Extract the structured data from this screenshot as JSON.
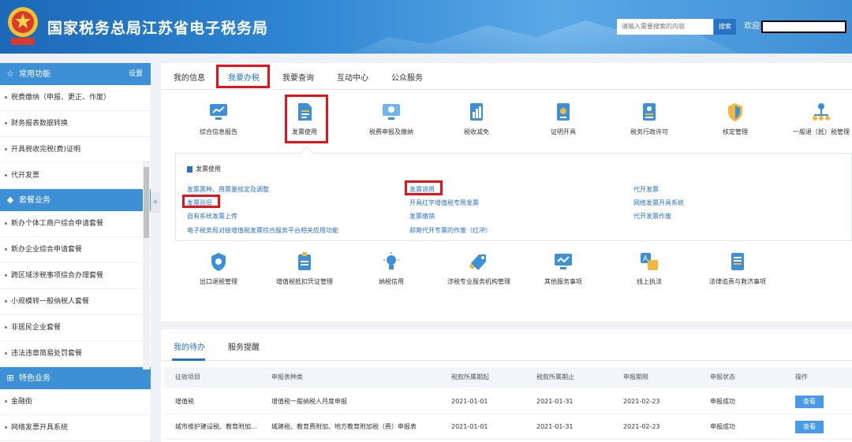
{
  "header": {
    "site_title": "国家税务总局江苏省电子税务局",
    "search_placeholder": "请输入需要搜索的内容",
    "search_label": "搜索",
    "welcome": "欢迎"
  },
  "sidebar": {
    "common": {
      "title": "常用功能",
      "settings": "设置",
      "items": [
        "税费缴纳（申报、更正、作废）",
        "财务报表数据转换",
        "开具税收完税(费)证明",
        "代开发票"
      ]
    },
    "packages": {
      "title": "套餐业务",
      "items": [
        "新办个体工商户综合申请套餐",
        "新办企业综合申请套餐",
        "跨区域涉税事项综合办理套餐",
        "小规模转一般纳税人套餐",
        "非居民企业套餐",
        "违法违章简易处罚套餐"
      ]
    },
    "featured": {
      "title": "特色业务",
      "items": [
        "金融街",
        "网络发票开具系统"
      ]
    }
  },
  "tabs": [
    "我的信息",
    "我要办税",
    "我要查询",
    "互动中心",
    "公众服务"
  ],
  "services_row1": [
    "综合信息报告",
    "发票使用",
    "税费申报及缴纳",
    "税收减免",
    "证明开具",
    "税务行政许可",
    "核定管理",
    "一般退（抵）税管理"
  ],
  "invoice_panel": {
    "title": "发票使用",
    "col1": [
      "发票票种、用票量核定及调整",
      "发票验旧",
      "自有系统发票上传",
      "电子税务局对接增值税发票综合服务平台相关应用功能"
    ],
    "col2": [
      "发票领用",
      "开具红字增值税专用发票",
      "发票缴销",
      "邮寄代开专票的作废（红冲）"
    ],
    "col3": [
      "代开发票",
      "网络发票开具系统",
      "代开发票作废"
    ]
  },
  "services_row2": [
    "出口退税管理",
    "增值税抵扣凭证管理",
    "纳税信用",
    "涉税专业服务机构管理",
    "其他服务事项",
    "线上执法",
    "法律追责与救济事项"
  ],
  "todo": {
    "tabs": [
      "我的待办",
      "服务提醒"
    ],
    "columns": [
      "征收项目",
      "申报表种类",
      "税款所属期起",
      "税款所属期止",
      "申报期限",
      "申报状态",
      "操作"
    ],
    "rows": [
      {
        "item": "增值税",
        "form": "增值税一般纳税人月度申报",
        "start": "2021-01-01",
        "end": "2021-01-31",
        "deadline": "2021-02-23",
        "status": "申报成功",
        "action": "查看"
      },
      {
        "item": "城市维护建设税、教育附加...",
        "form": "城建税、教育费附加、地方教育附加税（费）申报表",
        "start": "2021-01-01",
        "end": "2021-01-31",
        "deadline": "2021-02-23",
        "status": "申报成功",
        "action": "查看"
      }
    ]
  },
  "colors": {
    "header_blue": "#2f86d2",
    "sidebar_blue": "#3d8fd6",
    "link_blue": "#2a72c4",
    "highlight_red": "#e5141b"
  }
}
